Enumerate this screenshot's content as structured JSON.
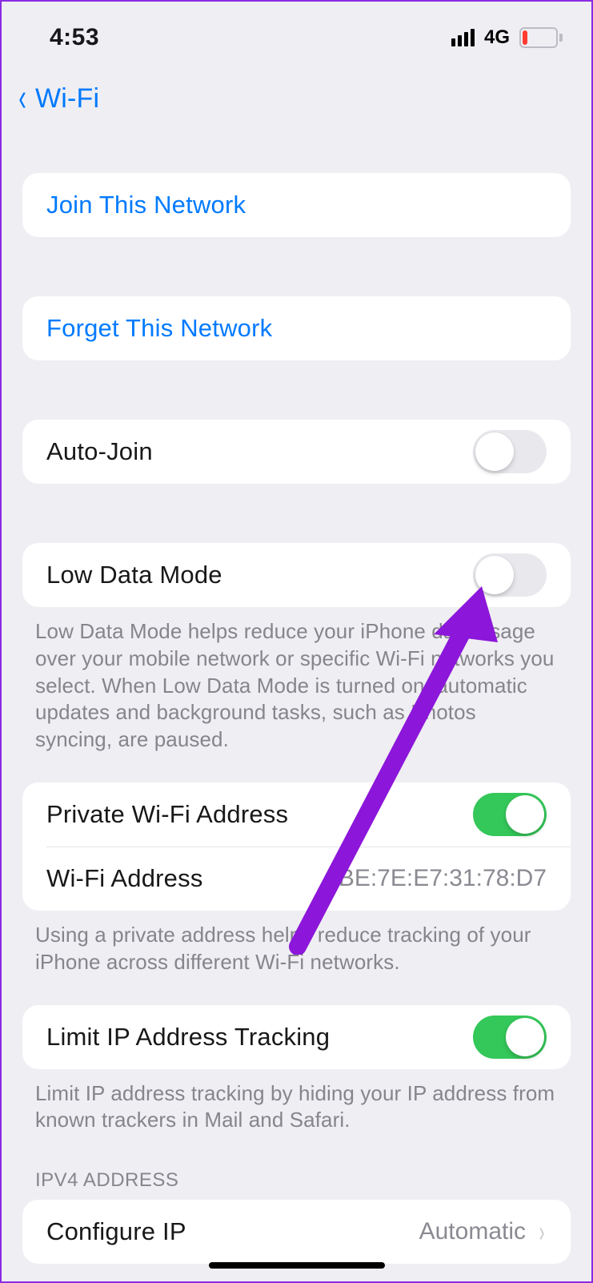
{
  "status": {
    "time": "4:53",
    "network": "4G"
  },
  "nav": {
    "back_label": "Wi-Fi"
  },
  "rows": {
    "join": "Join This Network",
    "forget": "Forget This Network",
    "auto_join": "Auto-Join",
    "low_data": "Low Data Mode",
    "private_addr": "Private Wi-Fi Address",
    "wifi_addr_label": "Wi-Fi Address",
    "wifi_addr_value": "BE:7E:E7:31:78:D7",
    "limit_ip": "Limit IP Address Tracking",
    "configure_ip_label": "Configure IP",
    "configure_ip_value": "Automatic"
  },
  "footers": {
    "low_data": "Low Data Mode helps reduce your iPhone data usage over your mobile network or specific Wi-Fi networks you select. When Low Data Mode is turned on, automatic updates and background tasks, such as Photos syncing, are paused.",
    "private_addr": "Using a private address helps reduce tracking of your iPhone across different Wi-Fi networks.",
    "limit_ip": "Limit IP address tracking by hiding your IP address from known trackers in Mail and Safari."
  },
  "sections": {
    "ipv4": "IPV4 ADDRESS"
  },
  "switches": {
    "auto_join": false,
    "low_data": false,
    "private_addr": true,
    "limit_ip": true
  },
  "colors": {
    "accent": "#007aff",
    "switch_on": "#34c759",
    "annotation": "#8c16d9"
  }
}
